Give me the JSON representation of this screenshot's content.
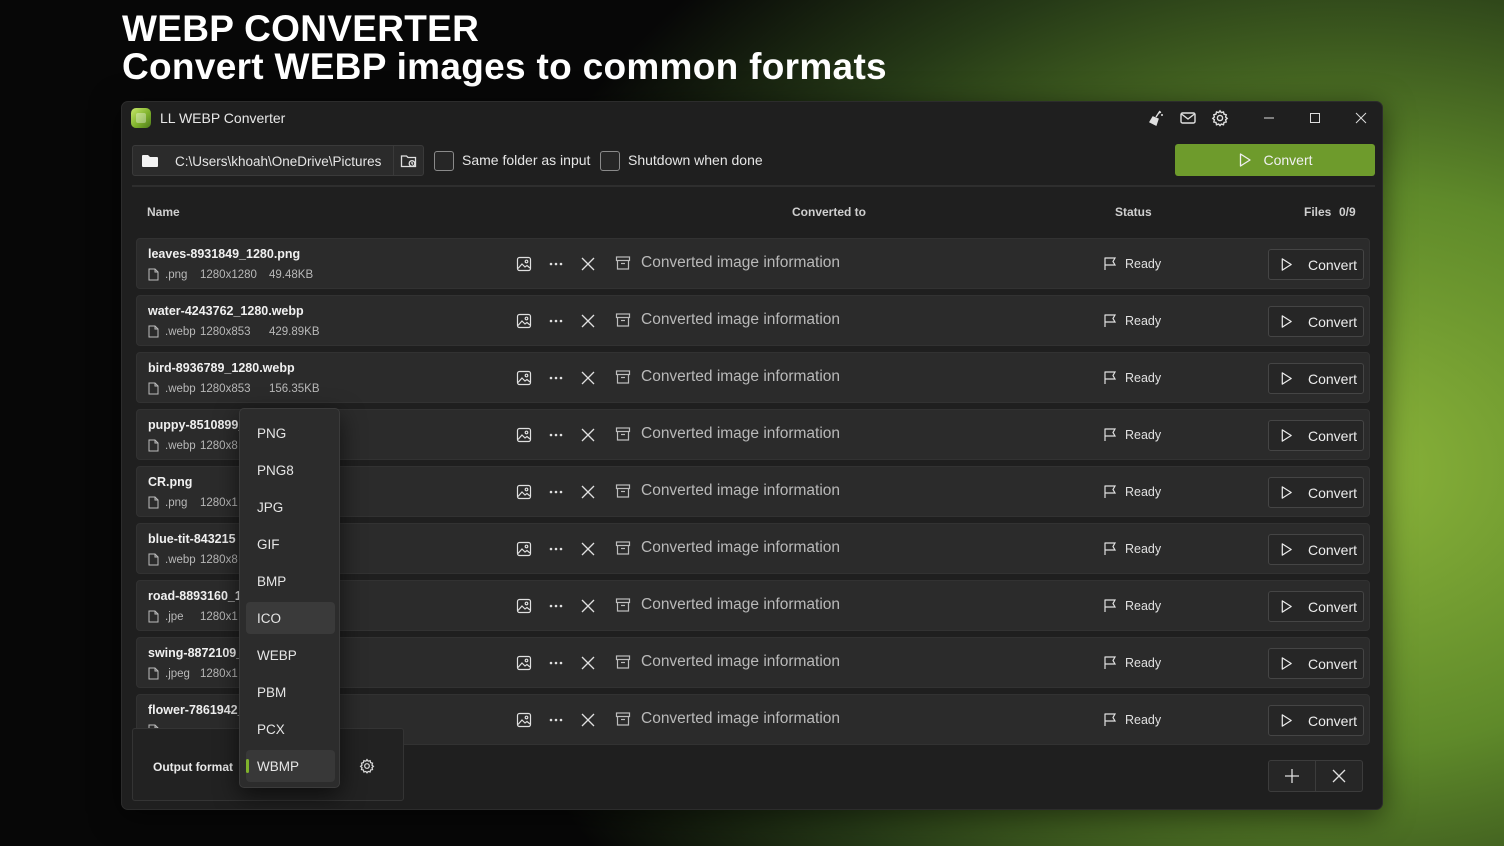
{
  "hero": {
    "title": "WEBP CONVERTER",
    "subtitle": "Convert WEBP images to common formats"
  },
  "window": {
    "title": "LL WEBP Converter",
    "titlebar_icons": [
      "broom-icon",
      "mail-icon",
      "gear-icon"
    ],
    "controls": [
      "minimize-icon",
      "maximize-icon",
      "close-icon"
    ]
  },
  "toolbar": {
    "path": "C:\\Users\\khoah\\OneDrive\\Pictures",
    "same_folder_label": "Same folder as input",
    "same_folder_checked": false,
    "shutdown_label": "Shutdown when done",
    "shutdown_checked": false,
    "convert_label": "Convert"
  },
  "table": {
    "columns": {
      "name": "Name",
      "converted_to": "Converted to",
      "status": "Status",
      "files_label": "Files",
      "files_count": "0/9"
    },
    "rows": [
      {
        "name": "leaves-8931849_1280.png",
        "ext": ".png",
        "dims": "1280x1280",
        "size": "49.48KB",
        "converted": "Converted image information",
        "status": "Ready",
        "action": "Convert"
      },
      {
        "name": "water-4243762_1280.webp",
        "ext": ".webp",
        "dims": "1280x853",
        "size": "429.89KB",
        "converted": "Converted image information",
        "status": "Ready",
        "action": "Convert"
      },
      {
        "name": "bird-8936789_1280.webp",
        "ext": ".webp",
        "dims": "1280x853",
        "size": "156.35KB",
        "converted": "Converted image information",
        "status": "Ready",
        "action": "Convert"
      },
      {
        "name": "puppy-8510899_",
        "ext": ".webp",
        "dims": "1280x8",
        "size": "",
        "converted": "Converted image information",
        "status": "Ready",
        "action": "Convert"
      },
      {
        "name": "CR.png",
        "ext": ".png",
        "dims": "1280x1",
        "size": "",
        "converted": "Converted image information",
        "status": "Ready",
        "action": "Convert"
      },
      {
        "name": "blue-tit-843215",
        "ext": ".webp",
        "dims": "1280x8",
        "size": "",
        "converted": "Converted image information",
        "status": "Ready",
        "action": "Convert"
      },
      {
        "name": "road-8893160_1",
        "ext": ".jpe",
        "dims": "1280x1",
        "size": "",
        "converted": "Converted image information",
        "status": "Ready",
        "action": "Convert"
      },
      {
        "name": "swing-8872109_",
        "ext": ".jpeg",
        "dims": "1280x1",
        "size": "",
        "converted": "Converted image information",
        "status": "Ready",
        "action": "Convert"
      },
      {
        "name": "flower-7861942_",
        "ext": "",
        "dims": "",
        "size": "",
        "converted": "Converted image information",
        "status": "Ready",
        "action": "Convert"
      }
    ]
  },
  "output": {
    "label": "Output format",
    "selected": "WBMP",
    "hovered": "ICO",
    "options": [
      "PNG",
      "PNG8",
      "JPG",
      "GIF",
      "BMP",
      "ICO",
      "WEBP",
      "PBM",
      "PCX",
      "WBMP"
    ]
  },
  "colors": {
    "accent": "#6e9b2c",
    "selection_indicator": "#7fb22c",
    "window_bg": "#1f1f1f",
    "row_bg": "#2b2b2b"
  }
}
